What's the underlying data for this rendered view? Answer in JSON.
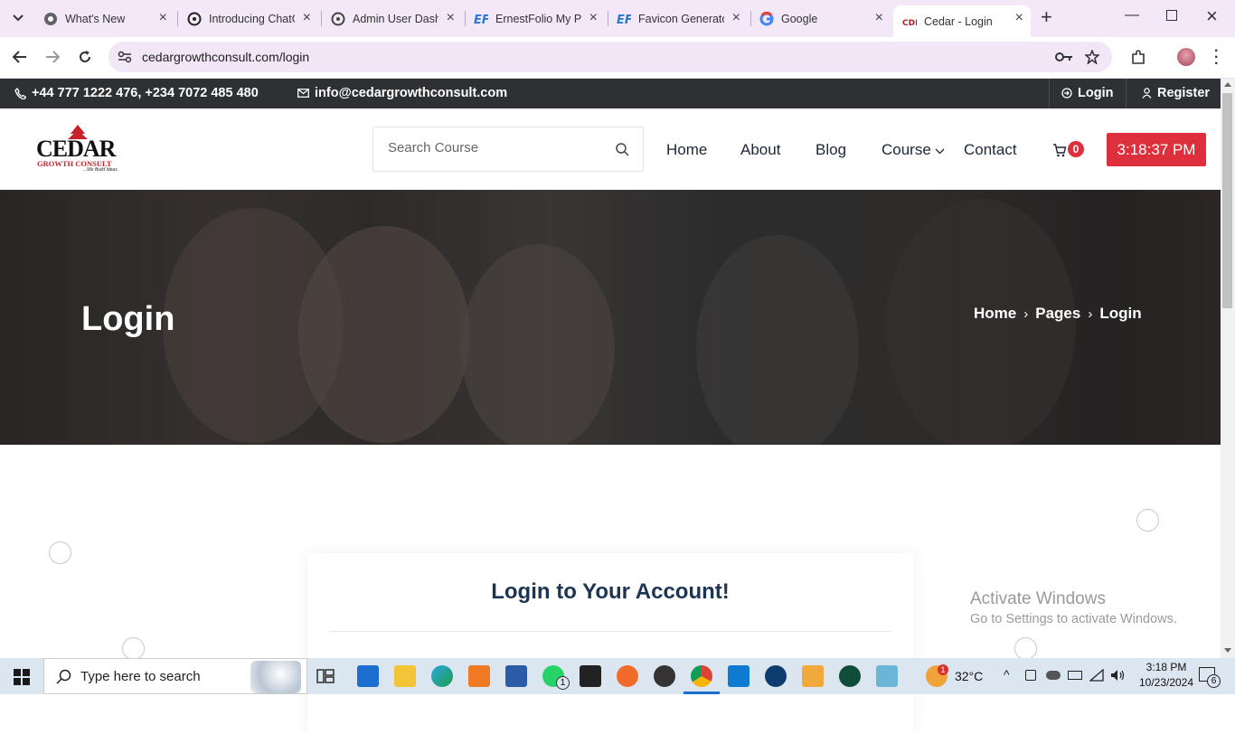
{
  "browser": {
    "tabs": [
      {
        "title": "What's New",
        "icon": "chrome-icon"
      },
      {
        "title": "Introducing ChatGPT",
        "icon": "openai-icon"
      },
      {
        "title": "Admin User Dashboard",
        "icon": "openai-icon"
      },
      {
        "title": "ErnestFolio My Portfolio",
        "icon": "ef-logo-icon"
      },
      {
        "title": "Favicon Generator",
        "icon": "ef-logo-icon"
      },
      {
        "title": "Google",
        "icon": "google-icon"
      },
      {
        "title": "Cedar - Login",
        "icon": "cedar-favicon",
        "active": true
      }
    ],
    "url": "cedargrowthconsult.com/login"
  },
  "topbar": {
    "phones": "+44 777 1222 476, +234 7072 485 480",
    "email": "info@cedargrowthconsult.com",
    "login": "Login",
    "register": "Register"
  },
  "header": {
    "logo_text": "CEDAR",
    "logo_sub": "GROWTH CONSULT",
    "logo_tag": "...We Build Ideas",
    "search_placeholder": "Search Course",
    "nav": [
      "Home",
      "About",
      "Blog",
      "Course",
      "Contact"
    ],
    "cart_count": "0",
    "time": "3:18:37 PM"
  },
  "hero": {
    "title": "Login",
    "breadcrumb": [
      "Home",
      "Pages",
      "Login"
    ]
  },
  "content": {
    "card_title": "Login to Your Account!",
    "watermark_title": "Activate Windows",
    "watermark_sub": "Go to Settings to activate Windows."
  },
  "taskbar": {
    "search_placeholder": "Type here to search",
    "weather": "32°C",
    "clock_time": "3:18 PM",
    "clock_date": "10/23/2024",
    "notif_count": "6",
    "whatsapp_badge": "1",
    "weather_badge": "1"
  },
  "colors": {
    "accent_red": "#dd2f3c",
    "topbar_bg": "#2f3034",
    "card_title": "#1c3553"
  }
}
